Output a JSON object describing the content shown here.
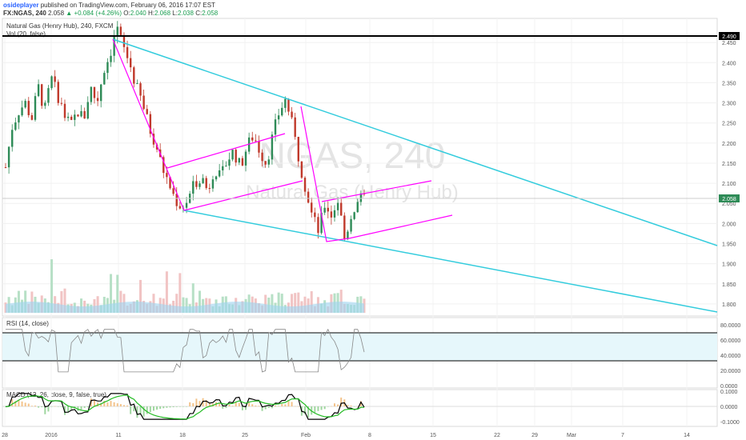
{
  "header": {
    "author": "osidepIayer",
    "published_text": "published on TradingView.com, February 06, 2016 17:07 EST",
    "symbol": "FX:NGAS, 240",
    "last": "2.058",
    "change": "▲ +0.084 (+4.26%)",
    "o_label": "O:",
    "o_value": "2.040",
    "h_label": "H:",
    "h_value": "2.068",
    "l_label": "L:",
    "l_value": "2.038",
    "c_label": "C:",
    "c_value": "2.058"
  },
  "main_pane": {
    "title": "Natural Gas (Henry Hub), 240, FXCM",
    "volume_label": "Vol (20, false)",
    "watermark_symbol": "NGAS, 240",
    "watermark_name": "Natural Gas (Henry Hub)",
    "price_ticks": [
      "2.450",
      "2.400",
      "2.350",
      "2.300",
      "2.250",
      "2.200",
      "2.150",
      "2.100",
      "2.050",
      "2.000",
      "1.950",
      "1.900",
      "1.850",
      "1.800"
    ],
    "resistance_label": "2.490",
    "last_price_label": "2.058"
  },
  "rsi_pane": {
    "title": "RSI (14, close)",
    "ticks": [
      "80.0000",
      "60.0000",
      "40.0000",
      "20.0000",
      "0.0000"
    ]
  },
  "macd_pane": {
    "title": "MACD (12, 26, close, 9, false, true)",
    "ticks": [
      "0.1000",
      "0.0000",
      "-0.1000"
    ]
  },
  "time_axis": [
    "28",
    "2016",
    "11",
    "18",
    "25",
    "Feb",
    "8",
    "15",
    "22",
    "29",
    "Mar",
    "7",
    "14"
  ],
  "colors": {
    "channel": "#33ccdd",
    "pattern": "#ff00ff",
    "up": "#2e8b57",
    "down": "#c0392b",
    "rsi_fill": "#e6f7fb",
    "macd_line": "#000000",
    "signal_line": "#22bb22"
  },
  "chart_data": [
    {
      "type": "candlestick",
      "title": "Natural Gas (Henry Hub), 240, FXCM",
      "x_ticks": [
        "28",
        "2016",
        "11",
        "18",
        "25",
        "Feb",
        "8",
        "15",
        "22",
        "29",
        "Mar",
        "7",
        "14"
      ],
      "ylim": [
        1.77,
        2.51
      ],
      "close_path": [
        2.14,
        2.24,
        2.28,
        2.3,
        2.26,
        2.34,
        2.28,
        2.36,
        2.32,
        2.27,
        2.24,
        2.28,
        2.26,
        2.34,
        2.3,
        2.38,
        2.42,
        2.49,
        2.44,
        2.4,
        2.34,
        2.3,
        2.24,
        2.2,
        2.14,
        2.1,
        2.06,
        2.04,
        2.06,
        2.1,
        2.12,
        2.08,
        2.14,
        2.11,
        2.16,
        2.18,
        2.14,
        2.19,
        2.22,
        2.18,
        2.15,
        2.22,
        2.28,
        2.31,
        2.24,
        2.16,
        2.09,
        2.02,
        1.98,
        2.05,
        2.02,
        2.06,
        1.96,
        2.02,
        2.06,
        2.058
      ],
      "last": 2.058,
      "resistance": 2.49
    },
    {
      "type": "line",
      "title": "RSI (14, close)",
      "ylim": [
        0,
        80
      ],
      "levels": [
        70,
        30
      ]
    },
    {
      "type": "line",
      "title": "MACD (12, 26, close, 9, false, true)",
      "ylim": [
        -0.1,
        0.1
      ]
    }
  ]
}
